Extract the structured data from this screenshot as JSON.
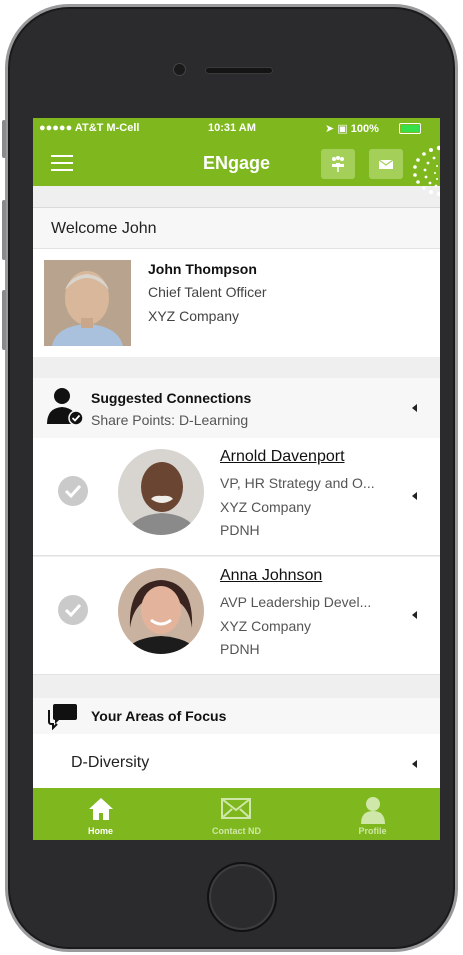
{
  "status": {
    "carrier": "●●●●● AT&T M-Cell",
    "time": "10:31 AM",
    "battery": "100%"
  },
  "nav": {
    "title": "ENgage"
  },
  "welcome": "Welcome John",
  "profile": {
    "name": "John Thompson",
    "title": "Chief Talent Officer",
    "company": "XYZ Company"
  },
  "suggested": {
    "title": "Suggested Connections",
    "subtitle": "Share Points: D-Learning",
    "connections": [
      {
        "name": "Arnold Davenport",
        "role": "VP, HR Strategy and O...",
        "company": "XYZ Company",
        "code": "PDNH"
      },
      {
        "name": "Anna Johnson",
        "role": "AVP Leadership Devel...",
        "company": "XYZ Company",
        "code": "PDNH"
      }
    ]
  },
  "focus": {
    "title": "Your Areas of Focus",
    "items": [
      "D-Diversity"
    ]
  },
  "tabs": [
    {
      "label": "Home",
      "icon": "home-icon"
    },
    {
      "label": "Contact ND",
      "icon": "mail-icon"
    },
    {
      "label": "Profile",
      "icon": "person-icon"
    }
  ],
  "colors": {
    "brand_green": "#7fb81e",
    "nav_button": "#a4d05a",
    "check_gray": "#cacaca"
  }
}
